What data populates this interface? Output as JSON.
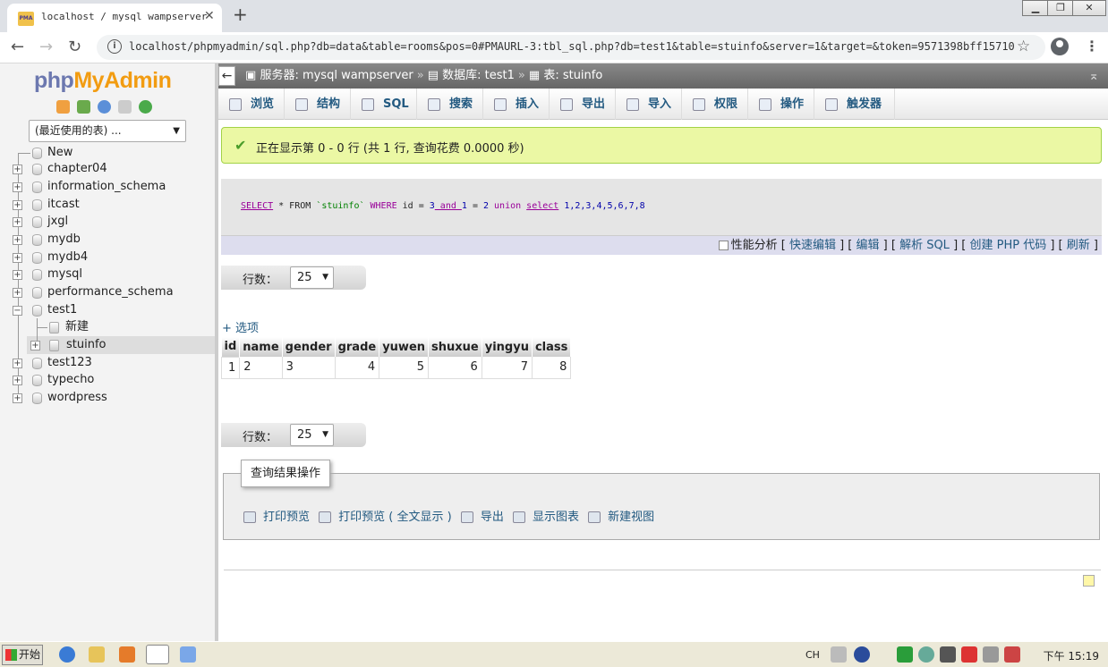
{
  "browser": {
    "tab_title": "localhost / mysql wampserver",
    "tab_favicon": "PMA",
    "url": "localhost/phpmyadmin/sql.php?db=data&table=rooms&pos=0#PMAURL-3:tbl_sql.php?db=test1&table=stuinfo&server=1&target=&token=9571398bff15710d…"
  },
  "logo": {
    "php": "php",
    "my": "My",
    "admin": "Admin"
  },
  "nav": {
    "db_select": "(最近使用的表) ...",
    "databases": [
      {
        "name": "New"
      },
      {
        "name": "chapter04"
      },
      {
        "name": "information_schema"
      },
      {
        "name": "itcast"
      },
      {
        "name": "jxgl"
      },
      {
        "name": "mydb"
      },
      {
        "name": "mydb4"
      },
      {
        "name": "mysql"
      },
      {
        "name": "performance_schema"
      },
      {
        "name": "test1"
      },
      {
        "name": "新建"
      },
      {
        "name": "stuinfo"
      },
      {
        "name": "test123"
      },
      {
        "name": "typecho"
      },
      {
        "name": "wordpress"
      }
    ]
  },
  "breadcrumb": {
    "server": "服务器: mysql wampserver",
    "database": "数据库: test1",
    "table": "表: stuinfo"
  },
  "tabs": [
    {
      "label": "浏览"
    },
    {
      "label": "结构"
    },
    {
      "label": "SQL"
    },
    {
      "label": "搜索"
    },
    {
      "label": "插入"
    },
    {
      "label": "导出"
    },
    {
      "label": "导入"
    },
    {
      "label": "权限"
    },
    {
      "label": "操作"
    },
    {
      "label": "触发器"
    }
  ],
  "notice": "正在显示第 0 - 0 行 (共 1 行, 查询花费 0.0000 秒)",
  "sql": {
    "t1": "SELECT",
    "t2": " * FROM ",
    "t3": "`stuinfo`",
    "t4": " WHERE ",
    "t5": "id",
    "t6": " = ",
    "t7": "3",
    "t8": " and ",
    "t9": "1",
    "t10": " = ",
    "t11": "2",
    "t12": " union ",
    "t13": "select",
    "t14": " 1,2,3,4,5,6,7,8"
  },
  "sql_options": {
    "profiling": "性能分析",
    "quick_edit": "快速编辑",
    "edit": "编辑",
    "explain": "解析 SQL",
    "create_php": "创建 PHP 代码",
    "refresh": "刷新"
  },
  "rows_label": "行数：",
  "rows_value": "25",
  "options_link": "+ 选项",
  "table": {
    "columns": [
      "id",
      "name",
      "gender",
      "grade",
      "yuwen",
      "shuxue",
      "yingyu",
      "class"
    ],
    "rows": [
      [
        "1",
        "2",
        "3",
        "4",
        "5",
        "6",
        "7",
        "8"
      ]
    ]
  },
  "query_ops": {
    "legend": "查询结果操作",
    "print": "打印预览",
    "print_full": "打印预览 ( 全文显示 )",
    "export": "导出",
    "chart": "显示图表",
    "create_view": "新建视图"
  },
  "taskbar": {
    "start": "开始",
    "lang": "CH",
    "clock": "下午 15:19"
  }
}
